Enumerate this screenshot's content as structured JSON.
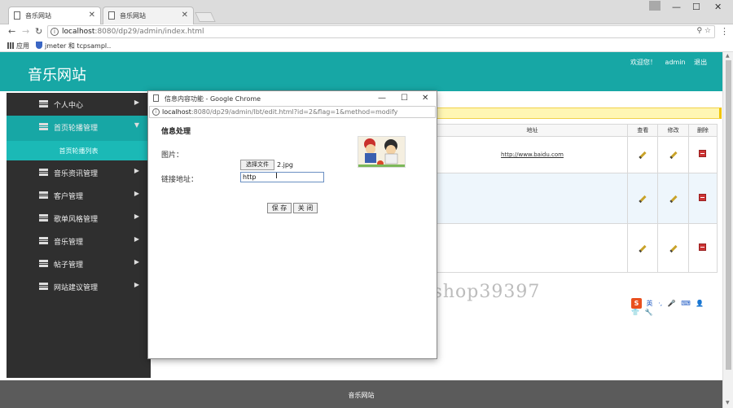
{
  "browser": {
    "tabs": [
      {
        "title": "音乐网站",
        "active": true
      },
      {
        "title": "音乐网站",
        "active": false
      }
    ],
    "window_controls": {
      "minimize": "—",
      "maximize": "☐",
      "close": "✕"
    },
    "url_host": "localhost",
    "url_path": ":8080/dp29/admin/index.html",
    "bookmarks": [
      {
        "label": "应用",
        "icon": "apps-grid-icon"
      },
      {
        "label": "jmeter 和 tcpsampl..",
        "icon": "shield-icon"
      }
    ]
  },
  "site": {
    "title": "音乐网站",
    "header_links": [
      "欢迎您！",
      "admin",
      "退出"
    ],
    "footer": "音乐网站"
  },
  "sidebar": {
    "items": [
      {
        "label": "个人中心",
        "arrow": "▶",
        "active": false
      },
      {
        "label": "首页轮播管理",
        "arrow": "▼",
        "active": true
      },
      {
        "label": "音乐资讯管理",
        "arrow": "▶",
        "active": false
      },
      {
        "label": "客户管理",
        "arrow": "▶",
        "active": false
      },
      {
        "label": "歌单风格管理",
        "arrow": "▶",
        "active": false
      },
      {
        "label": "音乐管理",
        "arrow": "▶",
        "active": false
      },
      {
        "label": "帖子管理",
        "arrow": "▶",
        "active": false
      },
      {
        "label": "网站建议管理",
        "arrow": "▶",
        "active": false
      }
    ],
    "sub_item": "首页轮播列表"
  },
  "table": {
    "headers": [
      "地址",
      "查看",
      "修改",
      "删除"
    ],
    "rows": [
      {
        "address": "http://www.baidu.com"
      },
      {
        "address": ""
      },
      {
        "address": ""
      }
    ]
  },
  "watermark": "https://www.huzhan.com/ishop39397",
  "ime_bar": {
    "logo": "S",
    "items": [
      "英",
      "·,",
      "🎤",
      "⌨",
      "👤",
      "👕",
      "🔧"
    ]
  },
  "popup": {
    "title": "信息内容功能 - Google Chrome",
    "url_host": "localhost",
    "url_path": ":8080/dp29/admin/lbt/edit.html?id=2&flag=1&method=modify",
    "heading": "信息处理",
    "image_label": "图片：",
    "choose_file": "选择文件",
    "file_name": "2.jpg",
    "link_label": "链接地址：",
    "link_value": "http",
    "save": "保 存",
    "close": "关 闭"
  },
  "colors": {
    "header": "#17a7a5",
    "sidebar": "#2f2f2f",
    "footer": "#5b5b5b"
  }
}
